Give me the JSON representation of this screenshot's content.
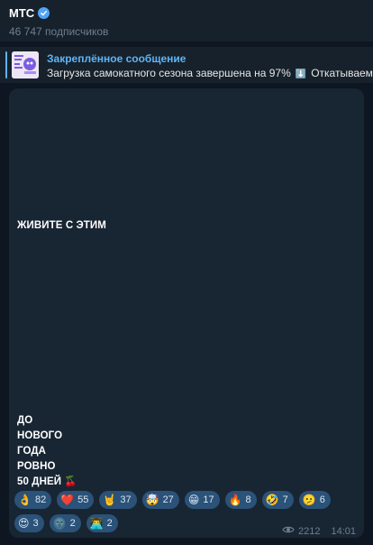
{
  "channel": {
    "name": "МТС",
    "subscribers": "46 747 подписчиков"
  },
  "pinned": {
    "title": "Закреплённое сообщение",
    "text": "Загрузка самокатного сезона завершена на 97%",
    "emoji": "⬇️",
    "text2": "Откатываем"
  },
  "message": {
    "line1": "ЖИВИТЕ С ЭТИМ",
    "lines": [
      "ДО",
      "НОВОГО",
      "ГОДА",
      "РОВНО",
      "50 ДНЕЙ"
    ],
    "tail_emoji": "🍒",
    "views": "2212",
    "time": "14:01"
  },
  "reactions": [
    {
      "emoji": "👌",
      "count": "82",
      "icon": "ok-hand-icon"
    },
    {
      "emoji": "❤️",
      "count": "55",
      "icon": "heart-icon"
    },
    {
      "emoji": "🤘",
      "count": "37",
      "icon": "rock-hand-icon"
    },
    {
      "emoji": "🤯",
      "count": "27",
      "icon": "mind-blown-icon"
    },
    {
      "emoji": "😁",
      "count": "17",
      "icon": "grin-icon"
    },
    {
      "emoji": "🔥",
      "count": "8",
      "icon": "fire-icon"
    },
    {
      "emoji": "🤣",
      "count": "7",
      "icon": "rofl-icon"
    },
    {
      "emoji": "🫤",
      "count": "6",
      "icon": "diagonal-mouth-icon"
    },
    {
      "emoji": "😍",
      "count": "3",
      "icon": "heart-eyes-icon"
    },
    {
      "emoji": "🌚",
      "count": "2",
      "icon": "dark-moon-icon"
    },
    {
      "emoji": "👨‍💻",
      "count": "2",
      "icon": "technologist-icon"
    }
  ]
}
